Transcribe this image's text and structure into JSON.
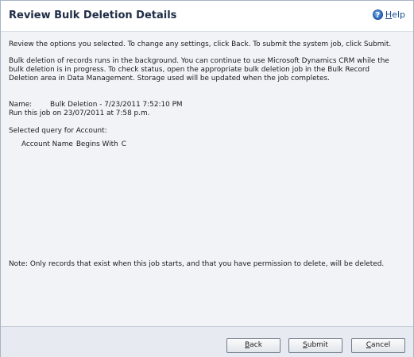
{
  "header": {
    "title": "Review Bulk Deletion Details",
    "help_label_accel": "H",
    "help_label_rest": "elp",
    "help_icon": "help-question-icon"
  },
  "content": {
    "intro": "Review the options you selected. To change any settings, click Back. To submit the system job, click Submit.",
    "background_lines": [
      "Bulk deletion of records runs in the background. You can continue to use Microsoft Dynamics CRM while the",
      "bulk deletion is in progress. To check status, open the appropriate bulk deletion job in the Bulk Record",
      "Deletion area in Data Management. Storage used will be updated when the job completes."
    ],
    "name_label": "Name:",
    "name_value": "Bulk Deletion - 7/23/2011 7:52:10 PM",
    "run_text": "Run this job on 23/07/2011 at 7:58 p.m.",
    "query_label": "Selected query for Account:",
    "query_condition": {
      "field": "Account Name",
      "operator": "Begins With",
      "value": "C"
    },
    "note": "Note: Only records that exist when this job starts, and that you have permission to delete, will be deleted."
  },
  "footer": {
    "back_accel": "B",
    "back_rest": "ack",
    "submit_accel": "S",
    "submit_rest": "ubmit",
    "cancel_accel": "C",
    "cancel_rest": "ancel"
  },
  "colors": {
    "title": "#1f2d46",
    "content_bg": "#f1f3f7",
    "footer_bg": "#e7ebf1",
    "link": "#1e4d8c"
  }
}
